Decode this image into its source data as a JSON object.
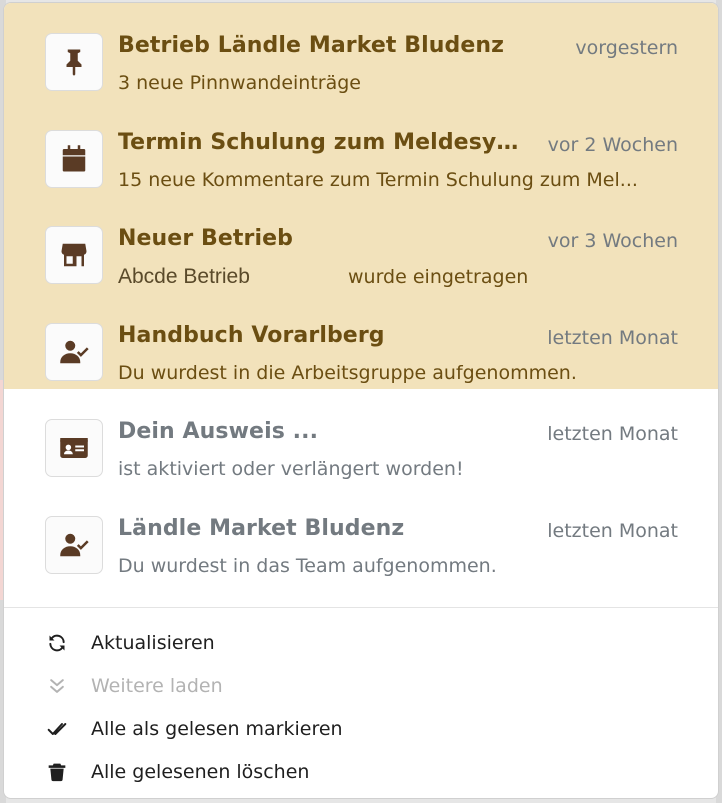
{
  "notifications": [
    {
      "icon": "pin-icon",
      "title": "Betrieb Ländle Market Bludenz",
      "time": "vorgestern",
      "description": "3 neue Pinnwandeinträge",
      "unread": true
    },
    {
      "icon": "calendar-icon",
      "title": "Termin Schulung zum Meldesyst...",
      "time": "vor 2 Wochen",
      "description": "15 neue Kommentare zum Termin Schulung zum Mel...",
      "unread": true
    },
    {
      "icon": "store-icon",
      "title": "Neuer Betrieb",
      "time": "vor 3 Wochen",
      "description_name": "Abcde Betrieb",
      "description_suffix": "wurde eingetragen",
      "unread": true
    },
    {
      "icon": "user-check-icon",
      "title": "Handbuch Vorarlberg",
      "time": "letzten Monat",
      "description": "Du wurdest in die Arbeitsgruppe aufgenommen.",
      "unread": true
    },
    {
      "icon": "id-card-icon",
      "title": "Dein Ausweis ...",
      "time": "letzten Monat",
      "description": "ist aktiviert oder verlängert worden!",
      "unread": false
    },
    {
      "icon": "user-check-icon",
      "title": "Ländle Market Bludenz",
      "time": "letzten Monat",
      "description": "Du wurdest in das Team aufgenommen.",
      "unread": false
    }
  ],
  "actions": [
    {
      "icon": "refresh-icon",
      "label": "Aktualisieren",
      "disabled": false
    },
    {
      "icon": "double-chevron-down-icon",
      "label": "Weitere laden",
      "disabled": true
    },
    {
      "icon": "double-check-icon",
      "label": "Alle als gelesen markieren",
      "disabled": false
    },
    {
      "icon": "trash-icon",
      "label": "Alle gelesenen löschen",
      "disabled": false
    }
  ],
  "colors": {
    "unread_bg": "#f2e2bb",
    "unread_text": "#6b4e12",
    "read_text": "#737a80",
    "icon_color": "#5a3b25"
  }
}
